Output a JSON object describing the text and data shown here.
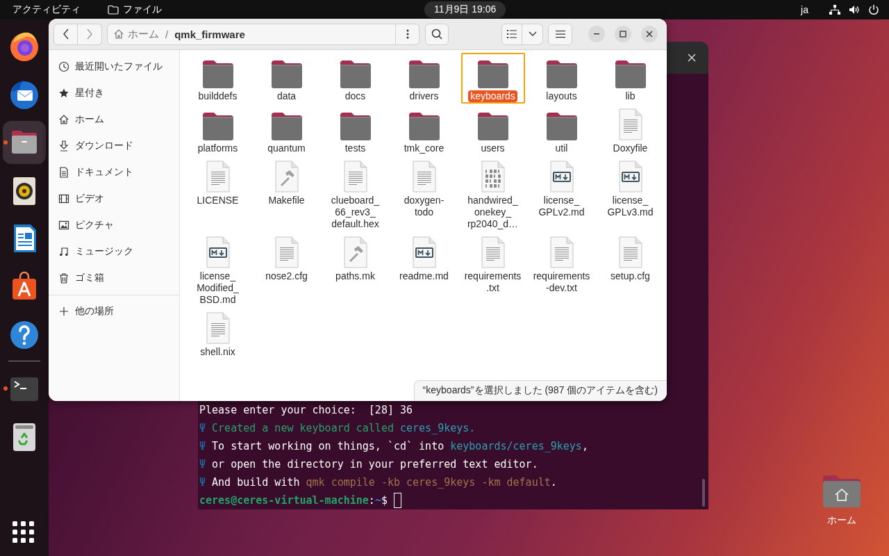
{
  "top_bar": {
    "activities": "アクティビティ",
    "app_menu": "ファイル",
    "clock": "11月9日 19:06",
    "input_method": "ja"
  },
  "dock": [
    {
      "kind": "firefox",
      "running": false,
      "selected": false
    },
    {
      "kind": "thunderbird",
      "running": false,
      "selected": false
    },
    {
      "kind": "files",
      "running": true,
      "selected": true
    },
    {
      "kind": "rhythmbox",
      "running": false,
      "selected": false
    },
    {
      "kind": "writer",
      "running": false,
      "selected": false
    },
    {
      "kind": "appcenter",
      "running": false,
      "selected": false
    },
    {
      "kind": "help",
      "running": false,
      "selected": false
    },
    {
      "kind": "terminal",
      "running": true,
      "selected": false
    },
    {
      "kind": "trash",
      "running": false,
      "selected": false
    }
  ],
  "terminal": {
    "lines": [
      {
        "segments": [
          {
            "text": "Please enter your choice:  [28] 36",
            "color": "#ffffff"
          }
        ]
      },
      {
        "segments": [
          {
            "text": "Ψ ",
            "color": "#1d6fa5"
          },
          {
            "text": "Created a new keyboard called ",
            "color": "#26a269"
          },
          {
            "text": "ceres_9keys.",
            "color": "#2aa1b3"
          }
        ]
      },
      {
        "segments": [
          {
            "text": "Ψ ",
            "color": "#1d6fa5"
          },
          {
            "text": "To start working on things, `cd` into ",
            "color": "#ffffff"
          },
          {
            "text": "keyboards/ceres_9keys",
            "color": "#2aa1b3"
          },
          {
            "text": ","
          }
        ]
      },
      {
        "segments": [
          {
            "text": "Ψ ",
            "color": "#1d6fa5"
          },
          {
            "text": "or open the directory in your preferred text editor.",
            "color": "#ffffff"
          }
        ]
      },
      {
        "segments": [
          {
            "text": "Ψ ",
            "color": "#1d6fa5"
          },
          {
            "text": "And build with ",
            "color": "#ffffff"
          },
          {
            "text": "qmk compile -kb ceres_9keys -km default",
            "color": "#a2734c"
          },
          {
            "text": "."
          }
        ]
      },
      {
        "cursor": true,
        "segments": [
          {
            "text": "ceres@ceres-virtual-machine",
            "color": "#26a269",
            "bold": true
          },
          {
            "text": ":",
            "color": "#ffffff"
          },
          {
            "text": "~",
            "color": "#2a7bde",
            "bold": true
          },
          {
            "text": "$ ",
            "color": "#ffffff"
          }
        ]
      }
    ]
  },
  "file_manager": {
    "path": {
      "parent": "ホーム",
      "separator": "/",
      "current": "qmk_firmware"
    },
    "sidebar": {
      "places": [
        {
          "label": "最近開いたファイル",
          "kind": "recent"
        },
        {
          "label": "星付き",
          "kind": "starred"
        },
        {
          "label": "ホーム",
          "kind": "home"
        },
        {
          "label": "ダウンロード",
          "kind": "downloads"
        },
        {
          "label": "ドキュメント",
          "kind": "documents"
        },
        {
          "label": "ビデオ",
          "kind": "videos"
        },
        {
          "label": "ピクチャ",
          "kind": "pictures"
        },
        {
          "label": "ミュージック",
          "kind": "music"
        },
        {
          "label": "ゴミ箱",
          "kind": "trash"
        }
      ],
      "other_locations": {
        "label": "他の場所"
      }
    },
    "files": [
      {
        "name": "builddefs",
        "kind": "folder",
        "selected": false
      },
      {
        "name": "data",
        "kind": "folder",
        "selected": false
      },
      {
        "name": "docs",
        "kind": "folder",
        "selected": false
      },
      {
        "name": "drivers",
        "kind": "folder",
        "selected": false
      },
      {
        "name": "keyboards",
        "kind": "folder",
        "selected": true
      },
      {
        "name": "layouts",
        "kind": "folder",
        "selected": false
      },
      {
        "name": "lib",
        "kind": "folder",
        "selected": false
      },
      {
        "name": "platforms",
        "kind": "folder",
        "selected": false
      },
      {
        "name": "quantum",
        "kind": "folder",
        "selected": false
      },
      {
        "name": "tests",
        "kind": "folder",
        "selected": false
      },
      {
        "name": "tmk_core",
        "kind": "folder",
        "selected": false
      },
      {
        "name": "users",
        "kind": "folder",
        "selected": false
      },
      {
        "name": "util",
        "kind": "folder",
        "selected": false
      },
      {
        "name": "Doxyfile",
        "kind": "text",
        "selected": false
      },
      {
        "name": "LICENSE",
        "kind": "text",
        "selected": false
      },
      {
        "name": "Makefile",
        "kind": "script",
        "selected": false
      },
      {
        "name": "clueboard_66_rev3_default.hex",
        "kind": "text",
        "selected": false
      },
      {
        "name": "doxygen-todo",
        "kind": "text",
        "selected": false
      },
      {
        "name": "handwired_onekey_rp2040_d…",
        "kind": "binary",
        "selected": false
      },
      {
        "name": "license_GPLv2.md",
        "kind": "markdown",
        "selected": false
      },
      {
        "name": "license_GPLv3.md",
        "kind": "markdown",
        "selected": false
      },
      {
        "name": "license_Modified_BSD.md",
        "kind": "markdown",
        "selected": false
      },
      {
        "name": "nose2.cfg",
        "kind": "text",
        "selected": false
      },
      {
        "name": "paths.mk",
        "kind": "script",
        "selected": false
      },
      {
        "name": "readme.md",
        "kind": "markdown",
        "selected": false
      },
      {
        "name": "requirements.txt",
        "kind": "text",
        "selected": false
      },
      {
        "name": "requirements-dev.txt",
        "kind": "text",
        "selected": false
      },
      {
        "name": "setup.cfg",
        "kind": "text",
        "selected": false
      },
      {
        "name": "shell.nix",
        "kind": "text",
        "selected": false
      }
    ],
    "status": "“keyboards”を選択しました (987 個のアイテムを含む)"
  },
  "desktop_icons": [
    {
      "label": "ホーム",
      "kind": "home"
    }
  ]
}
